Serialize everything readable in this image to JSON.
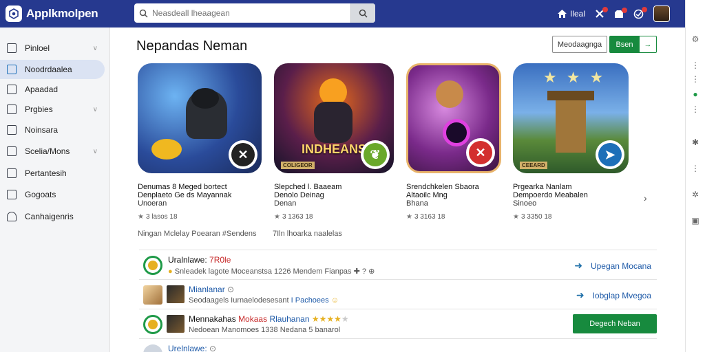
{
  "app": {
    "name": "Applkmolpen"
  },
  "search": {
    "placeholder": "Neasdeall lheaagean"
  },
  "topbar": {
    "action1_label": "Ileal"
  },
  "sidebar": {
    "items": [
      {
        "label": "Pinloel",
        "chevron": true
      },
      {
        "label": "Noodrdaalea",
        "active": true
      },
      {
        "label": "Apaadad"
      },
      {
        "label": "Prgbies",
        "chevron": true
      },
      {
        "label": "Noinsara"
      },
      {
        "label": "Scelia/Mons",
        "chevron": true
      },
      {
        "label": "Pertantesih"
      },
      {
        "label": "Gogoats"
      },
      {
        "label": "Canhaigenris"
      }
    ]
  },
  "main": {
    "title": "Nepandas Neman",
    "outline_button": "Meodaagnga",
    "split_button": "Bsen",
    "cards": [
      {
        "line1": "Denumas 8 Meged bortect",
        "line2": "Denplaeto Ge ds Mayannak",
        "line3": "Unoeran",
        "rating": "3 lasos 18",
        "badge": "tools"
      },
      {
        "line1": "Slepched l. Baaeam",
        "line2": "Denolo Deinag",
        "line3": "Denan",
        "rating": "3 1363 18",
        "badge": "leaf",
        "art_title": "INDHEANS",
        "art_tag": "COLIGEOR"
      },
      {
        "line1": "Srendchkelen Sbaora",
        "line2": "Altaoilc Mng",
        "line3": "Bhana",
        "rating": "3 3163 18",
        "badge": "close"
      },
      {
        "line1": "Prgearka Nanlam",
        "line2": "Dempoerdo Meabalen",
        "line3": "Sinoeo",
        "rating": "3 3350 18",
        "badge": "play",
        "art_tag": "CEEARD"
      }
    ],
    "subline_left": "Ningan Mclelay Poearan #Sendens",
    "subline_right": "7Iln lhoarka naalelas",
    "rows": [
      {
        "title": "Uralnlawe:",
        "title_hl": "7R0le",
        "sub": "Snleadek lagote Moceanstsa 1226 Mendem Fianpas",
        "action": "Upegan Mocana"
      },
      {
        "title": "Mianlanar",
        "sub": "Seodaagels Iurnaelodesesant",
        "sub_hl": "I Pachoees",
        "action": "Iobglap Mvegoa"
      },
      {
        "title": "Mennakahas",
        "title_hl_red": "Mokaas",
        "title_hl_blue": "Rlauhanan",
        "stars": 4,
        "sub": "Nedoean Manomoes 1338 Nedana 5 banarol",
        "button": "Degech Neban"
      },
      {
        "title": "Urelnlawe:",
        "sub": ""
      }
    ]
  },
  "colors": {
    "topbar": "#26398f",
    "primary_green": "#178a3e",
    "active_nav": "#dbe3f3",
    "link_blue": "#1e5aa8"
  }
}
